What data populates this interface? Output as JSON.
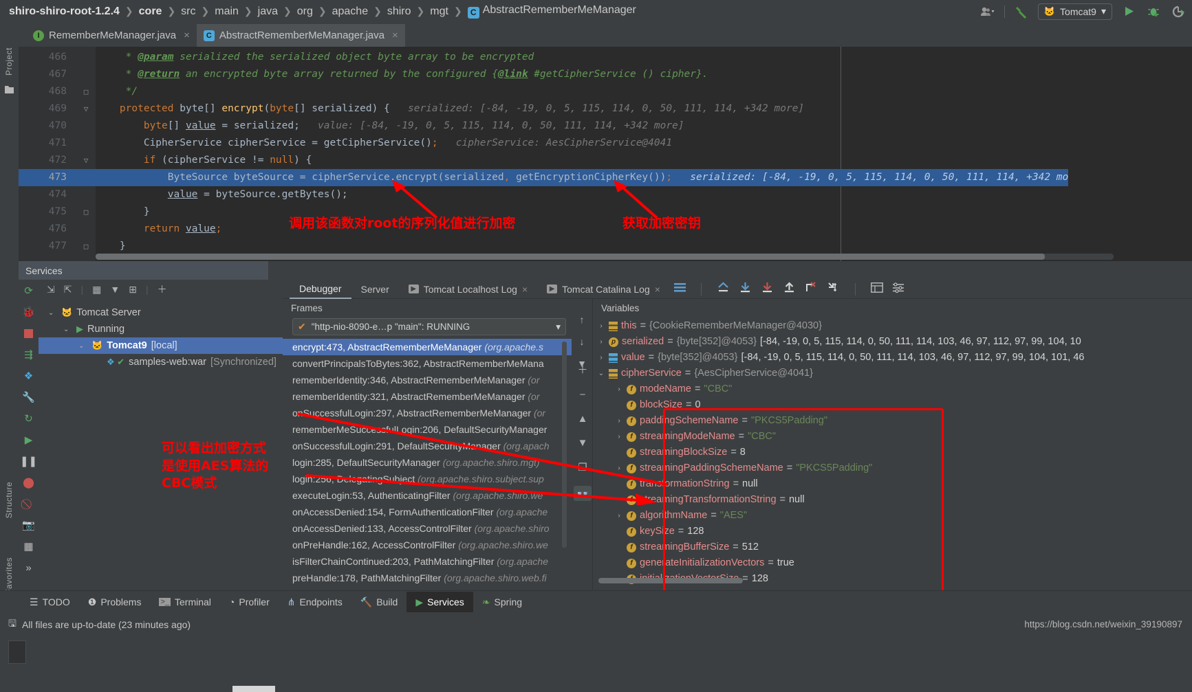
{
  "breadcrumb": {
    "items": [
      {
        "label": "shiro-shiro-root-1.2.4",
        "bold": true
      },
      {
        "label": "core",
        "bold": true
      },
      {
        "label": "src",
        "bold": false
      },
      {
        "label": "main",
        "bold": false
      },
      {
        "label": "java",
        "bold": false
      },
      {
        "label": "org",
        "bold": false
      },
      {
        "label": "apache",
        "bold": false
      },
      {
        "label": "shiro",
        "bold": false
      },
      {
        "label": "mgt",
        "bold": false
      },
      {
        "label": "AbstractRememberMeManager",
        "bold": false,
        "icon": "C"
      }
    ],
    "separator": "❯"
  },
  "toolbar_right": {
    "user_icon": "user-group-icon",
    "dropdown_caret": "▾",
    "build_icon": "hammer-icon",
    "run_config": "Tomcat9",
    "run_icon": "▶",
    "debug_icon": "bug-icon",
    "rerun_icon": "rerun-icon"
  },
  "editor_tabs": [
    {
      "label": "RememberMeManager.java",
      "kind": "I",
      "active": false,
      "close": "×"
    },
    {
      "label": "AbstractRememberMeManager.java",
      "kind": "C",
      "active": true,
      "close": "×"
    }
  ],
  "left_tool_labels": {
    "project": "Project",
    "structure": "Structure",
    "favorites": "Favorites"
  },
  "editor": {
    "lines": [
      {
        "num": "466",
        "fold": "",
        "segments": [
          {
            "t": "     * ",
            "c": "cmt"
          },
          {
            "t": "@param",
            "c": "tag"
          },
          {
            "t": " serialized the serialized object byte array to be encrypted",
            "c": "cmt"
          }
        ]
      },
      {
        "num": "467",
        "fold": "",
        "segments": [
          {
            "t": "     * ",
            "c": "cmt"
          },
          {
            "t": "@return",
            "c": "tag"
          },
          {
            "t": " an encrypted byte array returned by the configured {",
            "c": "cmt"
          },
          {
            "t": "@link",
            "c": "tag"
          },
          {
            "t": " #getCipherService () cipher}.",
            "c": "cmt"
          }
        ]
      },
      {
        "num": "468",
        "fold": "□",
        "segments": [
          {
            "t": "     */",
            "c": "cmt"
          }
        ]
      },
      {
        "num": "469",
        "fold": "▽",
        "segments": [
          {
            "t": "    ",
            "c": "typ"
          },
          {
            "t": "protected",
            "c": "kw"
          },
          {
            "t": " byte[] ",
            "c": "typ"
          },
          {
            "t": "encrypt",
            "c": "fn"
          },
          {
            "t": "(",
            "c": "typ"
          },
          {
            "t": "byte",
            "c": "kw"
          },
          {
            "t": "[] serialized) {",
            "c": "typ"
          },
          {
            "t": "   serialized: [-84, -19, 0, 5, 115, 114, 0, 50, 111, 114, +342 more]",
            "c": "hint"
          }
        ]
      },
      {
        "num": "470",
        "fold": "",
        "segments": [
          {
            "t": "        ",
            "c": "typ"
          },
          {
            "t": "byte",
            "c": "kw"
          },
          {
            "t": "[] ",
            "c": "typ"
          },
          {
            "t": "value",
            "c": "var-u"
          },
          {
            "t": " = serialized;",
            "c": "typ"
          },
          {
            "t": "   value: [-84, -19, 0, 5, 115, 114, 0, 50, 111, 114, +342 more]",
            "c": "hint"
          }
        ]
      },
      {
        "num": "471",
        "fold": "",
        "segments": [
          {
            "t": "        CipherService cipherService = getCipherService()",
            "c": "typ"
          },
          {
            "t": ";",
            "c": "punct"
          },
          {
            "t": "   cipherService: AesCipherService@4041",
            "c": "hint"
          }
        ]
      },
      {
        "num": "472",
        "fold": "▽",
        "segments": [
          {
            "t": "        ",
            "c": "typ"
          },
          {
            "t": "if",
            "c": "kw"
          },
          {
            "t": " (cipherService != ",
            "c": "typ"
          },
          {
            "t": "null",
            "c": "kw"
          },
          {
            "t": ") {",
            "c": "typ"
          }
        ]
      },
      {
        "num": "473",
        "fold": "",
        "highlight": true,
        "segments": [
          {
            "t": "            ByteSource byteSource = cipherService.encrypt(serialized",
            "c": "typ"
          },
          {
            "t": ",",
            "c": "punct"
          },
          {
            "t": " getEncryptionCipherKey())",
            "c": "typ"
          },
          {
            "t": ";",
            "c": "punct"
          },
          {
            "t": "   serialized: [-84, -19, 0, 5, 115, 114, 0, 50, 111, 114, +342 mo",
            "c": "hint-on-blue"
          }
        ]
      },
      {
        "num": "474",
        "fold": "",
        "segments": [
          {
            "t": "            ",
            "c": "typ"
          },
          {
            "t": "value",
            "c": "var-u"
          },
          {
            "t": " = byteSource.getBytes();",
            "c": "typ"
          }
        ]
      },
      {
        "num": "475",
        "fold": "□",
        "segments": [
          {
            "t": "        }",
            "c": "typ"
          }
        ]
      },
      {
        "num": "476",
        "fold": "",
        "segments": [
          {
            "t": "        ",
            "c": "typ"
          },
          {
            "t": "return",
            "c": "kw"
          },
          {
            "t": " ",
            "c": "typ"
          },
          {
            "t": "value",
            "c": "var-u"
          },
          {
            "t": ";",
            "c": "punct"
          }
        ]
      },
      {
        "num": "477",
        "fold": "□",
        "segments": [
          {
            "t": "    }",
            "c": "typ"
          }
        ]
      }
    ]
  },
  "annotations": [
    {
      "id": "ann-encrypt",
      "text": "调用该函数对root的序列化值进行加密"
    },
    {
      "id": "ann-key",
      "text": "获取加密密钥"
    },
    {
      "id": "ann-aes",
      "text": "可以看出加密方式\n是使用AES算法的\nCBC模式"
    }
  ],
  "services": {
    "title": "Services",
    "toolbar_icons": [
      "expand-all-icon",
      "collapse-all-icon",
      "group-icon",
      "filter-icon",
      "add-frame-icon",
      "add-icon"
    ],
    "side_icons": [
      "rerun-icon",
      "debug-icon",
      "stop-icon",
      "step-over-icon",
      "services-icon",
      "settings-icon",
      "refresh-icon",
      "resume-icon",
      "pause-icon",
      "record-icon",
      "mute-icon",
      "camera-icon",
      "layout-icon",
      "more-icon"
    ],
    "tree": [
      {
        "label": "Tomcat Server",
        "depth": 0,
        "chev": "⌄",
        "icon": "tomcat-icon",
        "selected": false
      },
      {
        "label": "Running",
        "depth": 1,
        "chev": "⌄",
        "icon": "run-icon",
        "selected": false
      },
      {
        "label": "Tomcat9",
        "suffix": " [local]",
        "depth": 2,
        "chev": "⌄",
        "icon": "tomcat-icon",
        "selected": true
      },
      {
        "label": "samples-web:war",
        "suffix": " [Synchronized]",
        "depth": 3,
        "chev": "",
        "icon": "artifact-icon",
        "selected": false
      }
    ]
  },
  "debugger": {
    "tabs": [
      {
        "label": "Debugger",
        "active": true,
        "closable": false
      },
      {
        "label": "Server",
        "active": false,
        "closable": false
      },
      {
        "label": "Tomcat Localhost Log",
        "active": false,
        "closable": true,
        "icon": "console-icon"
      },
      {
        "label": "Tomcat Catalina Log",
        "active": false,
        "closable": true,
        "icon": "console-icon"
      }
    ],
    "tool_icons": [
      "layout-settings-icon",
      "step-out-icon",
      "step-into-icon",
      "force-step-into-icon",
      "step-up-icon",
      "run-to-cursor-icon",
      "drop-frame-icon",
      "evaluate-icon",
      "settings-icon"
    ],
    "frames_caption": "Frames",
    "thread_selector": "\"http-nio-8090-e…p \"main\": RUNNING",
    "thread_dropdown_caret": "▾",
    "frames_toolbar": [
      "up-icon",
      "down-icon",
      "filter-icon"
    ],
    "frames": [
      {
        "method": "encrypt:473, AbstractRememberMeManager",
        "pkg": " (org.apache.s",
        "selected": true
      },
      {
        "method": "convertPrincipalsToBytes:362, AbstractRememberMeMana",
        "pkg": "",
        "selected": false
      },
      {
        "method": "rememberIdentity:346, AbstractRememberMeManager",
        "pkg": " (or",
        "selected": false
      },
      {
        "method": "rememberIdentity:321, AbstractRememberMeManager",
        "pkg": " (or",
        "selected": false
      },
      {
        "method": "onSuccessfulLogin:297, AbstractRememberMeManager",
        "pkg": " (or",
        "selected": false
      },
      {
        "method": "rememberMeSuccessfulLogin:206, DefaultSecurityManager",
        "pkg": "",
        "selected": false
      },
      {
        "method": "onSuccessfulLogin:291, DefaultSecurityManager",
        "pkg": " (org.apach",
        "selected": false
      },
      {
        "method": "login:285, DefaultSecurityManager",
        "pkg": " (org.apache.shiro.mgt)",
        "selected": false
      },
      {
        "method": "login:256, DelegatingSubject",
        "pkg": " (org.apache.shiro.subject.sup",
        "selected": false
      },
      {
        "method": "executeLogin:53, AuthenticatingFilter",
        "pkg": " (org.apache.shiro.we",
        "selected": false
      },
      {
        "method": "onAccessDenied:154, FormAuthenticationFilter",
        "pkg": " (org.apache",
        "selected": false
      },
      {
        "method": "onAccessDenied:133, AccessControlFilter",
        "pkg": " (org.apache.shiro",
        "selected": false
      },
      {
        "method": "onPreHandle:162, AccessControlFilter",
        "pkg": " (org.apache.shiro.we",
        "selected": false
      },
      {
        "method": "isFilterChainContinued:203, PathMatchingFilter",
        "pkg": " (org.apache",
        "selected": false
      },
      {
        "method": "preHandle:178, PathMatchingFilter",
        "pkg": " (org.apache.shiro.web.fi",
        "selected": false
      }
    ],
    "frames_side_actions": [
      "add-watch-icon",
      "remove-icon",
      "up-icon",
      "down-icon",
      "copy-icon",
      "mute-breakpoints-icon"
    ],
    "variables_caption": "Variables",
    "variables": [
      {
        "chev": "›",
        "badge": "field-group",
        "name": "this",
        "eq": " = ",
        "obj": "{CookieRememberMeManager@4030}",
        "value": "",
        "indent": 0
      },
      {
        "chev": "›",
        "badge": "param",
        "name": "serialized",
        "eq": " = ",
        "obj": "{byte[352]@4053}",
        "value": " [-84, -19, 0, 5, 115, 114, 0, 50, 111, 114, 103, 46, 97, 112, 97, 99, 104, 10",
        "indent": 0
      },
      {
        "chev": "›",
        "badge": "array",
        "name": "value",
        "eq": " = ",
        "obj": "{byte[352]@4053}",
        "value": " [-84, -19, 0, 5, 115, 114, 0, 50, 111, 114, 103, 46, 97, 112, 97, 99, 104, 101, 46",
        "indent": 0
      },
      {
        "chev": "⌄",
        "badge": "field-group",
        "name": "cipherService",
        "eq": " = ",
        "obj": "{AesCipherService@4041}",
        "value": "",
        "indent": 0
      },
      {
        "chev": "›",
        "badge": "f",
        "name": "modeName",
        "eq": " = ",
        "str": "\"CBC\"",
        "indent": 1
      },
      {
        "chev": "",
        "badge": "f",
        "name": "blockSize",
        "eq": " = ",
        "num": "0",
        "indent": 1
      },
      {
        "chev": "›",
        "badge": "f",
        "name": "paddingSchemeName",
        "eq": " = ",
        "str": "\"PKCS5Padding\"",
        "indent": 1
      },
      {
        "chev": "›",
        "badge": "f",
        "name": "streamingModeName",
        "eq": " = ",
        "str": "\"CBC\"",
        "indent": 1
      },
      {
        "chev": "",
        "badge": "f",
        "name": "streamingBlockSize",
        "eq": " = ",
        "num": "8",
        "indent": 1
      },
      {
        "chev": "›",
        "badge": "f",
        "name": "streamingPaddingSchemeName",
        "eq": " = ",
        "str": "\"PKCS5Padding\"",
        "indent": 1
      },
      {
        "chev": "",
        "badge": "f",
        "name": "transformationString",
        "eq": " = ",
        "num": "null",
        "indent": 1
      },
      {
        "chev": "",
        "badge": "f",
        "name": "streamingTransformationString",
        "eq": " = ",
        "num": "null",
        "indent": 1
      },
      {
        "chev": "›",
        "badge": "f",
        "name": "algorithmName",
        "eq": " = ",
        "str": "\"AES\"",
        "indent": 1
      },
      {
        "chev": "",
        "badge": "f",
        "name": "keySize",
        "eq": " = ",
        "num": "128",
        "indent": 1
      },
      {
        "chev": "",
        "badge": "f",
        "name": "streamingBufferSize",
        "eq": " = ",
        "num": "512",
        "indent": 1
      },
      {
        "chev": "",
        "badge": "f",
        "name": "generateInitializationVectors",
        "eq": " = ",
        "num": "true",
        "indent": 1
      },
      {
        "chev": "",
        "badge": "f",
        "name": "initializationVectorSize",
        "eq": " = ",
        "num": "128",
        "indent": 1
      }
    ]
  },
  "bottom_tabs": [
    {
      "label": "TODO",
      "icon": "todo-icon",
      "active": false
    },
    {
      "label": "Problems",
      "icon": "problems-icon",
      "active": false
    },
    {
      "label": "Terminal",
      "icon": "terminal-icon",
      "active": false
    },
    {
      "label": "Profiler",
      "icon": "profiler-icon",
      "active": false
    },
    {
      "label": "Endpoints",
      "icon": "endpoints-icon",
      "active": false
    },
    {
      "label": "Build",
      "icon": "build-icon",
      "active": false
    },
    {
      "label": "Services",
      "icon": "services-icon",
      "active": true
    },
    {
      "label": "Spring",
      "icon": "spring-icon",
      "active": false
    }
  ],
  "status": {
    "message": "All files are up-to-date (23 minutes ago)",
    "icon": "save-icon",
    "watermark": "https://blog.csdn.net/weixin_39190897"
  },
  "colors": {
    "accent_blue": "#4b6eaf",
    "selection": "#2f5b96",
    "annotation_red": "#ff0000",
    "panel_bg": "#3c3f41",
    "editor_bg": "#2b2b2b"
  }
}
